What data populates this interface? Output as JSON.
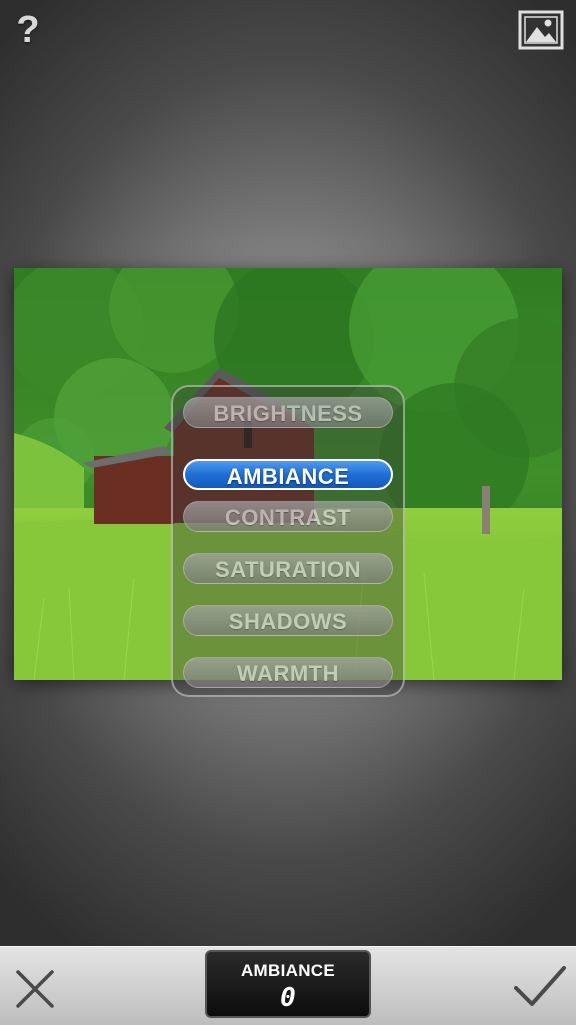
{
  "toolbar": {
    "help_label": "?",
    "gallery_icon": "image-gallery-icon"
  },
  "photo": {
    "subject": "barn-in-field"
  },
  "adjust_menu": {
    "items": [
      {
        "label": "BRIGHTNESS",
        "active": false
      },
      {
        "label": "AMBIANCE",
        "active": true
      },
      {
        "label": "CONTRAST",
        "active": false
      },
      {
        "label": "SATURATION",
        "active": false
      },
      {
        "label": "SHADOWS",
        "active": false
      },
      {
        "label": "WARMTH",
        "active": false
      }
    ],
    "active_color": "#1f6fd6"
  },
  "bottom_bar": {
    "cancel_icon": "close-icon",
    "apply_icon": "checkmark-icon",
    "param_name": "AMBIANCE",
    "param_value": "0"
  }
}
